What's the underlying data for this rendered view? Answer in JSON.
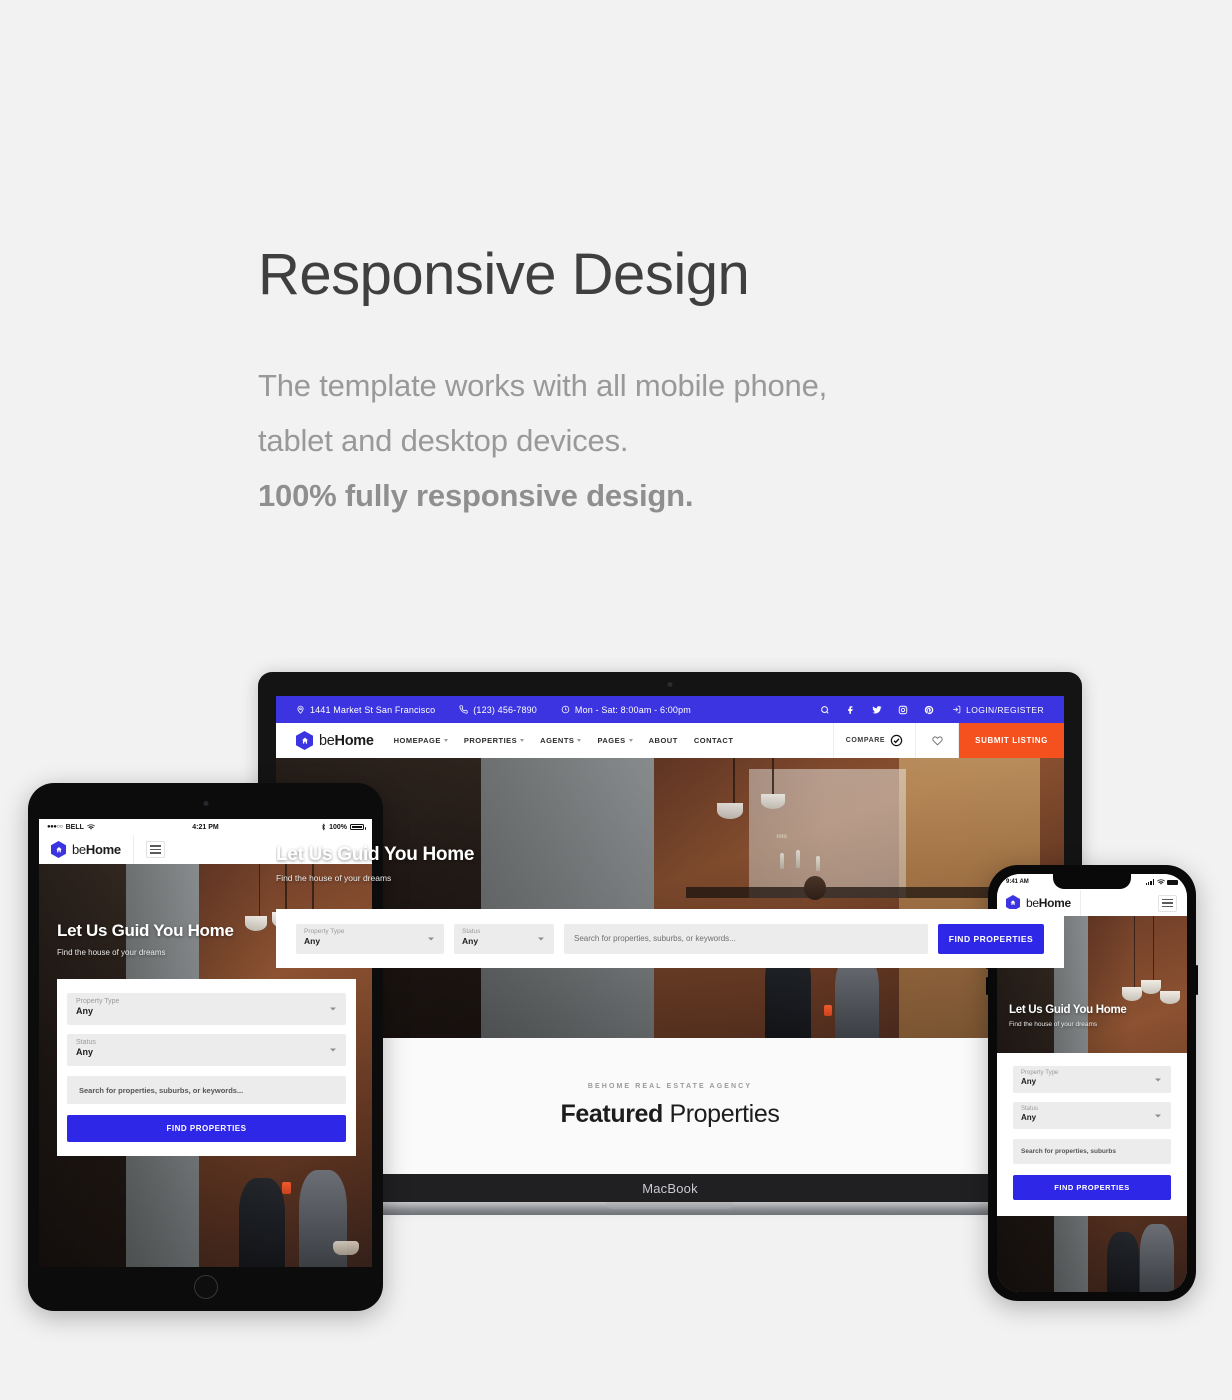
{
  "hero_text": {
    "headline": "Responsive Design",
    "para_line1": "The template works with all mobile phone,",
    "para_line2": "tablet and desktop devices.",
    "para_line3": "100% fully responsive design."
  },
  "brand": {
    "prefix": "be",
    "suffix": "Home",
    "logo_icon": "hexagon-home-pin-icon"
  },
  "site": {
    "topbar": {
      "address": "1441 Market St San Francisco",
      "address_icon": "map-pin-icon",
      "phone": "(123) 456-7890",
      "phone_icon": "phone-icon",
      "hours": "Mon - Sat: 8:00am - 6:00pm",
      "hours_icon": "clock-icon",
      "social": [
        "search-icon",
        "facebook-icon",
        "twitter-icon",
        "instagram-icon",
        "pinterest-icon"
      ],
      "login_label": "LOGIN/REGISTER",
      "login_icon": "login-icon",
      "bg_color": "#3b34e0"
    },
    "nav": {
      "items": [
        {
          "label": "HOMEPAGE",
          "has_dropdown": true
        },
        {
          "label": "PROPERTIES",
          "has_dropdown": true
        },
        {
          "label": "AGENTS",
          "has_dropdown": true
        },
        {
          "label": "PAGES",
          "has_dropdown": true
        },
        {
          "label": "ABOUT",
          "has_dropdown": false
        },
        {
          "label": "CONTACT",
          "has_dropdown": false
        }
      ],
      "compare_label": "COMPARE",
      "compare_icon": "check-circle-icon",
      "wishlist_icon": "heart-icon",
      "submit_label": "SUBMIT LISTING",
      "submit_color": "#f4511e"
    },
    "hero": {
      "title": "Let Us Guid You Home",
      "subtitle": "Find the house of your dreams",
      "photo_caption": "nilo"
    },
    "search": {
      "property_type_label": "Property Type",
      "property_type_value": "Any",
      "status_label": "Status",
      "status_value": "Any",
      "keyword_placeholder": "Search for properties, suburbs, or keywords...",
      "keyword_placeholder_short": "Search for properties, suburbs",
      "submit_label": "FIND PROPERTIES",
      "submit_color": "#2f27e8"
    },
    "featured": {
      "kicker": "BEHOME REAL ESTATE AGENCY",
      "title_bold": "Featured",
      "title_light": " Properties"
    }
  },
  "devices": {
    "laptop": {
      "label": "MacBook"
    },
    "tablet": {
      "carrier": "BELL",
      "signal_dots": "●●●○○",
      "wifi_icon": "wifi-icon",
      "time": "4:21 PM",
      "bluetooth_icon": "bluetooth-icon",
      "battery_percent": "100%",
      "menu_icon": "hamburger-menu-icon"
    },
    "phone": {
      "time": "9:41 AM",
      "signal_icon": "cell-signal-icon",
      "wifi_icon": "wifi-icon",
      "battery_icon": "battery-icon",
      "menu_icon": "hamburger-menu-icon"
    }
  }
}
